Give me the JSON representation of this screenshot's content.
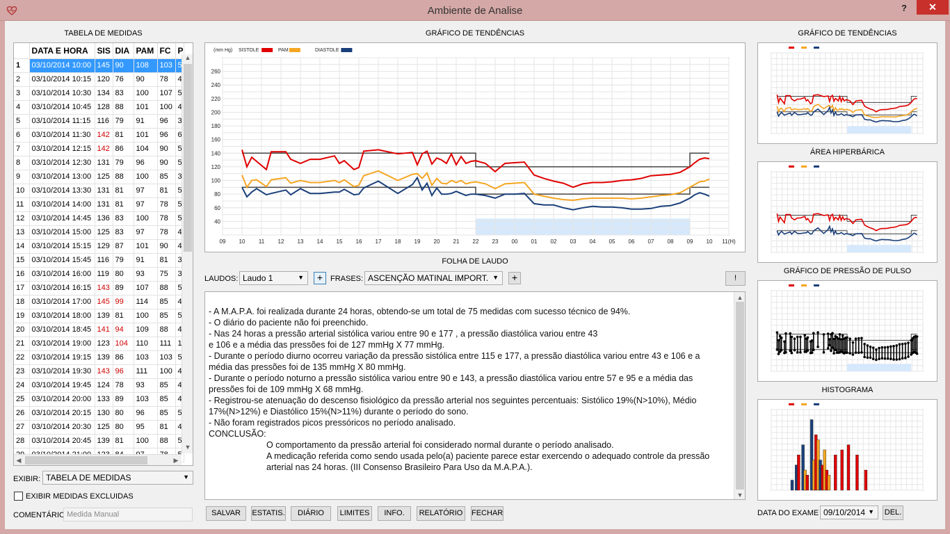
{
  "window": {
    "title": "Ambiente de Analise",
    "help": "?",
    "close": "✕"
  },
  "table": {
    "title": "TABELA DE MEDIDAS",
    "columns": [
      "DATA E HORA",
      "SIS",
      "DIA",
      "PAM",
      "FC",
      "P"
    ],
    "rows": [
      {
        "n": "1",
        "dt": "03/10/2014 10:00",
        "sis": "145",
        "dia": "90",
        "pam": "108",
        "fc": "103",
        "p": "5"
      },
      {
        "n": "2",
        "dt": "03/10/2014 10:15",
        "sis": "120",
        "dia": "76",
        "pam": "90",
        "fc": "78",
        "p": "4"
      },
      {
        "n": "3",
        "dt": "03/10/2014 10:30",
        "sis": "134",
        "dia": "83",
        "pam": "100",
        "fc": "107",
        "p": "5"
      },
      {
        "n": "4",
        "dt": "03/10/2014 10:45",
        "sis": "128",
        "dia": "88",
        "pam": "101",
        "fc": "100",
        "p": "4"
      },
      {
        "n": "5",
        "dt": "03/10/2014 11:15",
        "sis": "116",
        "dia": "79",
        "pam": "91",
        "fc": "96",
        "p": "3"
      },
      {
        "n": "6",
        "dt": "03/10/2014 11:30",
        "sis": "142",
        "dia": "81",
        "pam": "101",
        "fc": "96",
        "p": "6"
      },
      {
        "n": "7",
        "dt": "03/10/2014 12:15",
        "sis": "142",
        "dia": "86",
        "pam": "104",
        "fc": "90",
        "p": "5"
      },
      {
        "n": "8",
        "dt": "03/10/2014 12:30",
        "sis": "131",
        "dia": "79",
        "pam": "96",
        "fc": "90",
        "p": "5"
      },
      {
        "n": "9",
        "dt": "03/10/2014 13:00",
        "sis": "125",
        "dia": "88",
        "pam": "100",
        "fc": "85",
        "p": "3"
      },
      {
        "n": "10",
        "dt": "03/10/2014 13:30",
        "sis": "131",
        "dia": "81",
        "pam": "97",
        "fc": "81",
        "p": "5"
      },
      {
        "n": "11",
        "dt": "03/10/2014 14:00",
        "sis": "131",
        "dia": "81",
        "pam": "97",
        "fc": "78",
        "p": "5"
      },
      {
        "n": "12",
        "dt": "03/10/2014 14:45",
        "sis": "136",
        "dia": "83",
        "pam": "100",
        "fc": "78",
        "p": "5"
      },
      {
        "n": "13",
        "dt": "03/10/2014 15:00",
        "sis": "125",
        "dia": "83",
        "pam": "97",
        "fc": "78",
        "p": "4"
      },
      {
        "n": "14",
        "dt": "03/10/2014 15:15",
        "sis": "129",
        "dia": "87",
        "pam": "101",
        "fc": "90",
        "p": "4"
      },
      {
        "n": "15",
        "dt": "03/10/2014 15:45",
        "sis": "116",
        "dia": "79",
        "pam": "91",
        "fc": "81",
        "p": "3"
      },
      {
        "n": "16",
        "dt": "03/10/2014 16:00",
        "sis": "119",
        "dia": "80",
        "pam": "93",
        "fc": "75",
        "p": "3"
      },
      {
        "n": "17",
        "dt": "03/10/2014 16:15",
        "sis": "143",
        "dia": "89",
        "pam": "107",
        "fc": "88",
        "p": "5"
      },
      {
        "n": "18",
        "dt": "03/10/2014 17:00",
        "sis": "145",
        "dia": "99",
        "pam": "114",
        "fc": "85",
        "p": "4"
      },
      {
        "n": "19",
        "dt": "03/10/2014 18:00",
        "sis": "139",
        "dia": "81",
        "pam": "100",
        "fc": "85",
        "p": "5"
      },
      {
        "n": "20",
        "dt": "03/10/2014 18:45",
        "sis": "141",
        "dia": "94",
        "pam": "109",
        "fc": "88",
        "p": "4"
      },
      {
        "n": "21",
        "dt": "03/10/2014 19:00",
        "sis": "123",
        "dia": "104",
        "pam": "110",
        "fc": "111",
        "p": "1"
      },
      {
        "n": "22",
        "dt": "03/10/2014 19:15",
        "sis": "139",
        "dia": "86",
        "pam": "103",
        "fc": "103",
        "p": "5"
      },
      {
        "n": "23",
        "dt": "03/10/2014 19:30",
        "sis": "143",
        "dia": "96",
        "pam": "111",
        "fc": "100",
        "p": "4"
      },
      {
        "n": "24",
        "dt": "03/10/2014 19:45",
        "sis": "124",
        "dia": "78",
        "pam": "93",
        "fc": "85",
        "p": "4"
      },
      {
        "n": "25",
        "dt": "03/10/2014 20:00",
        "sis": "133",
        "dia": "89",
        "pam": "103",
        "fc": "85",
        "p": "4"
      },
      {
        "n": "26",
        "dt": "03/10/2014 20:15",
        "sis": "130",
        "dia": "80",
        "pam": "96",
        "fc": "85",
        "p": "5"
      },
      {
        "n": "27",
        "dt": "03/10/2014 20:30",
        "sis": "125",
        "dia": "80",
        "pam": "95",
        "fc": "81",
        "p": "4"
      },
      {
        "n": "28",
        "dt": "03/10/2014 20:45",
        "sis": "139",
        "dia": "81",
        "pam": "100",
        "fc": "88",
        "p": "5"
      },
      {
        "n": "29",
        "dt": "03/10/2014 21:00",
        "sis": "123",
        "dia": "84",
        "pam": "97",
        "fc": "78",
        "p": "5"
      }
    ],
    "red_cells": [
      [
        5,
        "sis"
      ],
      [
        6,
        "sis"
      ],
      [
        16,
        "sis"
      ],
      [
        17,
        "sis"
      ],
      [
        17,
        "dia"
      ],
      [
        19,
        "sis"
      ],
      [
        19,
        "dia"
      ],
      [
        20,
        "dia"
      ],
      [
        22,
        "sis"
      ],
      [
        22,
        "dia"
      ]
    ]
  },
  "left_controls": {
    "exibir_label": "EXIBIR:",
    "exibir_value": "TABELA DE MEDIDAS",
    "excluidas_label": "EXIBIR MEDIDAS EXCLUIDAS",
    "comentario_label": "COMENTÁRIO",
    "comentario_placeholder": "Medida Manual"
  },
  "main_chart": {
    "title": "GRÁFICO DE TENDÊNCIAS",
    "unit": "(mm Hg)",
    "legend": [
      "SISTOLE",
      "PAM",
      "DIASTOLE"
    ]
  },
  "chart_data": [
    {
      "type": "line",
      "title": "GRÁFICO DE TENDÊNCIAS",
      "ylabel": "(mm Hg)",
      "xlabel": "(H)",
      "x_ticks": [
        "09",
        "10",
        "11",
        "12",
        "13",
        "14",
        "15",
        "16",
        "17",
        "18",
        "19",
        "20",
        "21",
        "22",
        "23",
        "00",
        "01",
        "02",
        "03",
        "04",
        "05",
        "06",
        "07",
        "08",
        "09",
        "10",
        "11(H)"
      ],
      "y_ticks": [
        40,
        60,
        80,
        100,
        120,
        140,
        160,
        180,
        200,
        220,
        240,
        260
      ],
      "ylim": [
        20,
        280
      ],
      "sleep_band": {
        "from": 22,
        "to": 33
      },
      "limits": {
        "sistolic_day": 140,
        "sistolic_night": 120,
        "diastolic_day": 90,
        "diastolic_night": 80
      },
      "series": [
        {
          "name": "SISTOLE",
          "color": "#e00000",
          "x": [
            10,
            10.25,
            10.5,
            10.75,
            11.25,
            11.5,
            12.25,
            12.5,
            13,
            13.5,
            14,
            14.75,
            15,
            15.25,
            15.75,
            16,
            16.25,
            17,
            18,
            18.75,
            19,
            19.25,
            19.5,
            19.75,
            20,
            20.25,
            20.5,
            20.75,
            21,
            21.25,
            21.5,
            21.75,
            22,
            22.5,
            23,
            23.5,
            24,
            24.5,
            25,
            25.5,
            26,
            26.5,
            27,
            27.5,
            28,
            28.5,
            29,
            29.5,
            30,
            30.5,
            31,
            31.5,
            32,
            32.5,
            33,
            33.25,
            33.5,
            33.75,
            34
          ],
          "y": [
            145,
            120,
            134,
            128,
            116,
            142,
            142,
            131,
            125,
            131,
            131,
            136,
            125,
            129,
            116,
            119,
            143,
            145,
            139,
            141,
            123,
            139,
            143,
            124,
            133,
            130,
            125,
            139,
            123,
            135,
            125,
            128,
            129,
            125,
            113,
            125,
            126,
            127,
            108,
            103,
            99,
            96,
            90,
            95,
            97,
            97,
            98,
            100,
            101,
            103,
            107,
            108,
            109,
            112,
            120,
            126,
            131,
            133,
            132
          ]
        },
        {
          "name": "PAM",
          "color": "#f5a623",
          "x": [
            10,
            10.25,
            10.5,
            10.75,
            11.25,
            11.5,
            12.25,
            12.5,
            13,
            13.5,
            14,
            14.75,
            15,
            15.25,
            15.75,
            16,
            16.25,
            17,
            18,
            18.75,
            19,
            19.25,
            19.5,
            19.75,
            20,
            20.25,
            20.5,
            20.75,
            21,
            21.25,
            21.5,
            21.75,
            22,
            22.5,
            23,
            23.5,
            24,
            24.5,
            25,
            25.5,
            26,
            26.5,
            27,
            27.5,
            28,
            28.5,
            29,
            29.5,
            30,
            30.5,
            31,
            31.5,
            32,
            32.5,
            33,
            33.25,
            33.5,
            33.75,
            34
          ],
          "y": [
            108,
            90,
            100,
            101,
            91,
            101,
            104,
            96,
            100,
            97,
            97,
            100,
            97,
            101,
            91,
            93,
            107,
            114,
            100,
            109,
            110,
            103,
            111,
            93,
            103,
            96,
            95,
            100,
            97,
            100,
            95,
            97,
            98,
            95,
            88,
            95,
            96,
            97,
            80,
            77,
            74,
            72,
            71,
            73,
            74,
            74,
            74,
            74,
            73,
            74,
            76,
            78,
            79,
            82,
            90,
            94,
            98,
            99,
            102
          ]
        },
        {
          "name": "DIASTOLE",
          "color": "#1a3f7a",
          "x": [
            10,
            10.25,
            10.5,
            10.75,
            11.25,
            11.5,
            12.25,
            12.5,
            13,
            13.5,
            14,
            14.75,
            15,
            15.25,
            15.75,
            16,
            16.25,
            17,
            18,
            18.75,
            19,
            19.25,
            19.5,
            19.75,
            20,
            20.25,
            20.5,
            20.75,
            21,
            21.25,
            21.5,
            21.75,
            22,
            22.5,
            23,
            23.5,
            24,
            24.5,
            25,
            25.5,
            26,
            26.5,
            27,
            27.5,
            28,
            28.5,
            29,
            29.5,
            30,
            30.5,
            31,
            31.5,
            32,
            32.5,
            33,
            33.25,
            33.5,
            33.75,
            34
          ],
          "y": [
            90,
            76,
            83,
            88,
            79,
            81,
            86,
            79,
            88,
            81,
            81,
            83,
            83,
            87,
            79,
            80,
            89,
            99,
            81,
            94,
            104,
            86,
            96,
            78,
            89,
            80,
            80,
            81,
            84,
            81,
            78,
            80,
            80,
            78,
            74,
            80,
            80,
            81,
            66,
            64,
            64,
            60,
            57,
            60,
            62,
            61,
            61,
            60,
            58,
            58,
            59,
            62,
            63,
            67,
            74,
            79,
            82,
            80,
            77
          ]
        }
      ]
    }
  ],
  "side_charts": {
    "tendencias": "GRÁFICO DE TENDÊNCIAS",
    "hiperbarica": "ÁREA HIPERBÁRICA",
    "pulso": "GRÁFICO DE PRESSÃO DE PULSO",
    "histograma": "HISTOGRAMA"
  },
  "laudo": {
    "title": "FOLHA DE LAUDO",
    "laudos_label": "LAUDOS:",
    "laudos_value": "Laudo 1",
    "frases_label": "FRASES:",
    "frases_value": "ASCENÇÃO MATINAL IMPORT.",
    "bang": "!",
    "plus": "+",
    "lines": [
      "- A M.A.P.A.  foi realizada durante 24 horas, obtendo-se um total de 75 medidas com sucesso técnico de 94%.",
      "- O diário do paciente não foi preenchido.",
      "- Nas 24 horas a pressão arterial sistólica variou entre 90 e 177 , a pressão diastólica variou entre 43",
      "e 106 e a média das pressões foi de 127 mmHg X 77 mmHg.",
      "- Durante o período diurno ocorreu variação da pressão sistólica entre 115 e 177, a pressão diastólica variou entre 43 e 106 e a",
      "média das pressões foi de 135 mmHg X 80 mmHg.",
      "- Durante o período noturno a pressão sistólica variou entre 90 e 143, a pressão diastólica variou entre 57 e 95 e a média das",
      "pressões foi de 109 mmHg X 68 mmHg.",
      "- Registrou-se atenuação do descenso fisiológico da pressão arterial nos seguintes percentuais: Sistólico 19%(N>10%), Médio",
      "17%(N>12%) e Diastólico 15%(N>11%) durante o período do sono.",
      "- Não foram registrados picos pressóricos no período analisado."
    ],
    "conclusao_label": "CONCLUSÃO:",
    "conclusao_lines": [
      "O comportamento da pressão arterial foi considerado normal durante o período analisado.",
      "A medicação referida como sendo usada pelo(a) paciente parece estar exercendo o adequado controle da pressão",
      "arterial nas 24 horas. (III Consenso Brasileiro Para Uso da M.A.P.A.)."
    ]
  },
  "bottom_buttons": {
    "salvar": "SALVAR",
    "estatis": "ESTATIS.",
    "diario": "DIÁRIO",
    "limites": "LIMITES",
    "info": "INFO.",
    "relatorio": "RELATÓRIO",
    "fechar": "FECHAR"
  },
  "exam": {
    "label": "DATA DO EXAME :",
    "value": "09/10/2014",
    "del": "DEL."
  }
}
